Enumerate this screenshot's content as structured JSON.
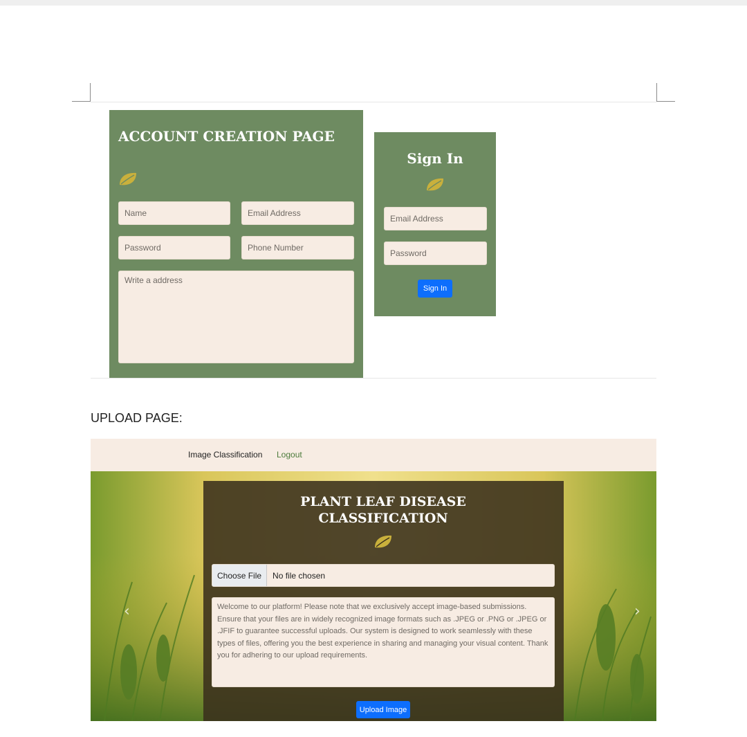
{
  "account_page": {
    "title": "ACCOUNT CREATION PAGE",
    "fields": {
      "name": "Name",
      "email": "Email Address",
      "password": "Password",
      "phone": "Phone Number",
      "address": "Write a address"
    }
  },
  "signin_page": {
    "title": "Sign In",
    "fields": {
      "email": "Email Address",
      "password": "Password"
    },
    "button": "Sign In"
  },
  "upload_page": {
    "label": "UPLOAD PAGE:",
    "nav": {
      "home": "Image Classification",
      "logout": "Logout"
    },
    "title": "PLANT LEAF DISEASE CLASSIFICATION",
    "file_button": "Choose File",
    "file_status": "No file chosen",
    "description": "Welcome to our platform! Please note that we exclusively accept image-based submissions. Ensure that your files are in widely recognized image formats such as .JPEG or .PNG or .JPEG or .JFIF to guarantee successful uploads. Our system is designed to work seamlessly with these types of files, offering you the best experience in sharing and managing your visual content. Thank you for adhering to our upload requirements.",
    "upload_button": "Upload Image",
    "carousel": {
      "prev": "‹",
      "next": "›"
    }
  },
  "colors": {
    "panel_green": "#6e8b61",
    "field_bg": "#f7ece3",
    "button_blue": "#0d6efd",
    "leaf_yellow": "#c9b03c",
    "logout_green": "#4b7a3a"
  }
}
